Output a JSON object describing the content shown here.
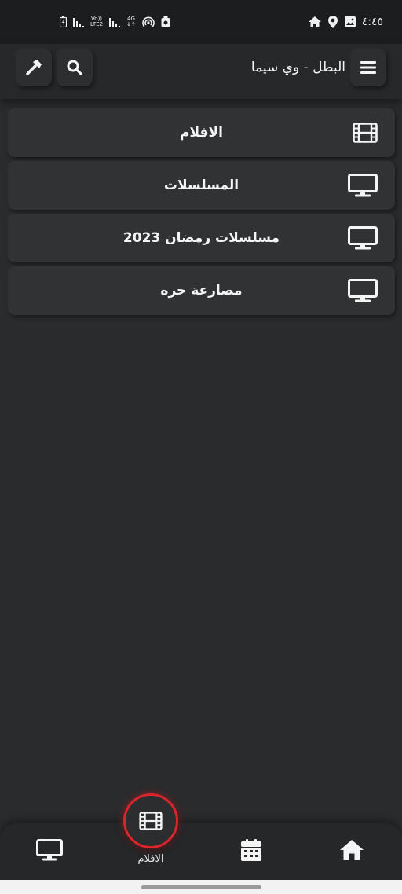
{
  "status_bar": {
    "time": "٤:٤٥",
    "volte": "Vo))",
    "lte": "LTE2",
    "network": "4G"
  },
  "app_bar": {
    "title": "البطل - وي سيما"
  },
  "menu": {
    "items": [
      {
        "label": "الافلام",
        "icon": "film-icon"
      },
      {
        "label": "المسلسلات",
        "icon": "tv-icon"
      },
      {
        "label": "مسلسلات رمضان 2023",
        "icon": "tv-icon"
      },
      {
        "label": "مصارعة حره",
        "icon": "tv-icon"
      }
    ]
  },
  "bottom_nav": {
    "active_label": "الافلام",
    "items": [
      "home-icon",
      "calendar-icon",
      "film-icon",
      "tv-icon"
    ]
  },
  "colors": {
    "background": "#2a2b2d",
    "card": "#313234",
    "accent": "#d9262c",
    "text": "#f5f5f5"
  }
}
